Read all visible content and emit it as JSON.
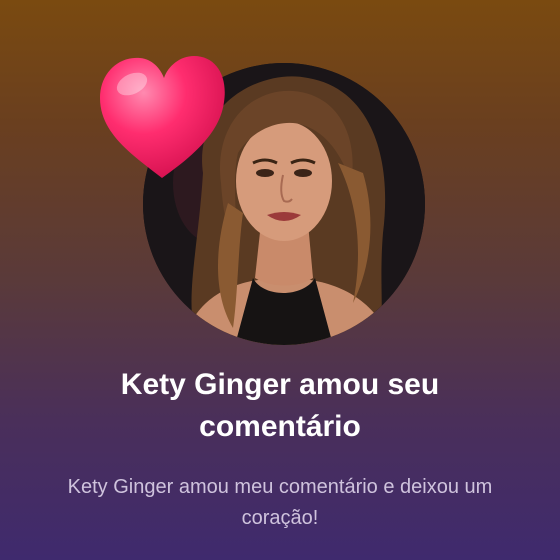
{
  "notification": {
    "title": "Kety Ginger amou seu comentário",
    "message": "Kety Ginger amou meu comentário e deixou um coração!",
    "avatar_alt": "Kety Ginger",
    "icon": "heart-icon"
  },
  "colors": {
    "background_top": "#7a4a10",
    "background_bottom": "#3f2a6e",
    "heart": "#ff2d6f",
    "title_text": "#ffffff",
    "message_text": "#cfc3dd"
  }
}
